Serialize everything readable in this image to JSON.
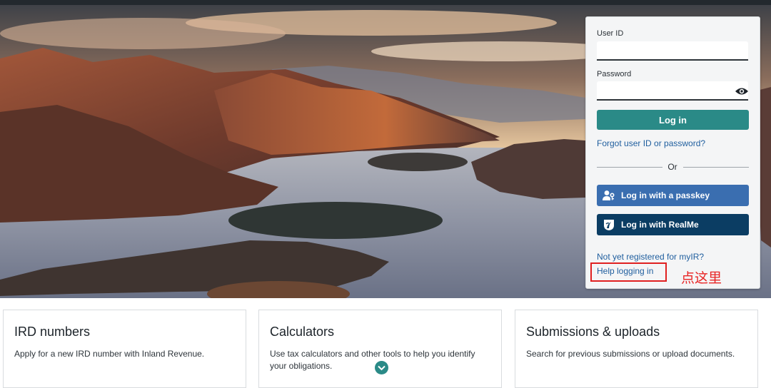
{
  "login": {
    "userid_label": "User ID",
    "userid_value": "",
    "password_label": "Password",
    "password_value": "",
    "login_button": "Log in",
    "forgot_link": "Forgot user ID or password?",
    "or_text": "Or",
    "passkey_button": "Log in with a passkey",
    "realme_button": "Log in with RealMe",
    "register_link": "Not yet registered for myIR?",
    "help_link": "Help logging in"
  },
  "annotation": {
    "text": "点这里",
    "color": "#e02020"
  },
  "cards": [
    {
      "title": "IRD numbers",
      "desc": "Apply for a new IRD number with Inland Revenue."
    },
    {
      "title": "Calculators",
      "desc": "Use tax calculators and other tools to help you identify your obligations."
    },
    {
      "title": "Submissions & uploads",
      "desc": "Search for previous submissions or upload documents."
    }
  ],
  "icons": {
    "password_toggle": "eye-icon",
    "passkey": "passkey-person-icon",
    "realme": "realme-fern-icon",
    "scroll": "chevron-down-icon"
  },
  "colors": {
    "primary": "#2a8a87",
    "passkey_button": "#3a6eb0",
    "realme_button": "#0b3d63",
    "link": "#1f5e9e"
  }
}
